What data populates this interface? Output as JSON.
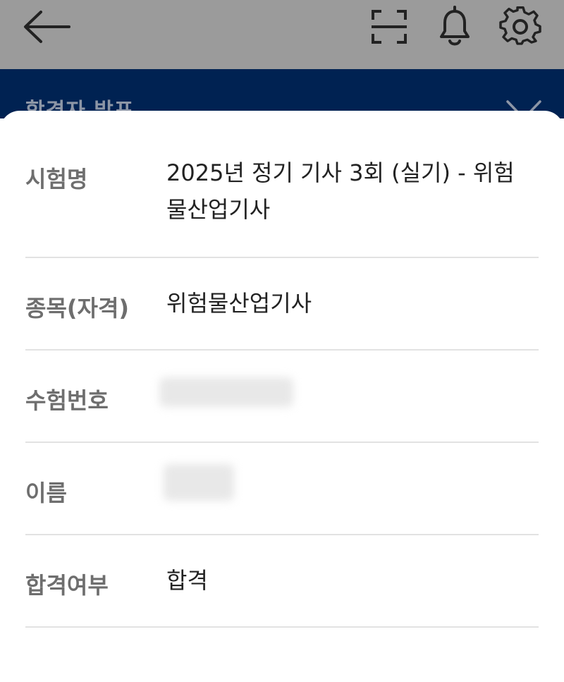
{
  "topbar": {
    "icons": [
      "back-arrow-icon",
      "scan-icon",
      "bell-icon",
      "gear-icon"
    ],
    "background": "#9b9b9b"
  },
  "banner": {
    "title": "합격자 발표",
    "background": "#002252"
  },
  "result": {
    "rows": [
      {
        "label": "시험명",
        "value": "2025년 정기 기사 3회 (실기) - 위험물산업기사"
      },
      {
        "label": "종목(자격)",
        "value": "위험물산업기사"
      },
      {
        "label": "수험번호",
        "value": ""
      },
      {
        "label": "이름",
        "value": ""
      },
      {
        "label": "합격여부",
        "value": "합격"
      }
    ]
  }
}
